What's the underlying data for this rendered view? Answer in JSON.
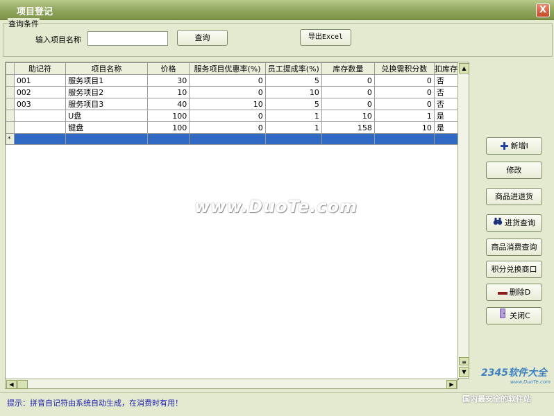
{
  "window": {
    "title": "项目登记",
    "close_label": "X"
  },
  "query": {
    "group_label": "查询条件",
    "name_label": "输入项目名称",
    "name_value": "",
    "query_button": "查询",
    "export_button": "导出Excel"
  },
  "grid": {
    "columns": [
      "助记符",
      "项目名称",
      "价格",
      "服务项目优惠率(%)",
      "员工提成率(%)",
      "库存数量",
      "兑换需积分数",
      "扣库存"
    ],
    "rows": [
      [
        "001",
        "服务项目1",
        "30",
        "0",
        "5",
        "0",
        "0",
        "否"
      ],
      [
        "002",
        "服务项目2",
        "10",
        "0",
        "10",
        "0",
        "0",
        "否"
      ],
      [
        "003",
        "服务项目3",
        "40",
        "10",
        "5",
        "0",
        "0",
        "否"
      ],
      [
        "",
        "U盘",
        "100",
        "0",
        "1",
        "10",
        "1",
        "是"
      ],
      [
        "",
        "键盘",
        "100",
        "0",
        "1",
        "158",
        "10",
        "是"
      ]
    ],
    "new_row_marker": "*"
  },
  "actions": {
    "add": "新增I",
    "edit": "修改",
    "returns": "商品进退货",
    "purchase_query": "进货查询",
    "consume_query": "商品消费查询",
    "points_exchange": "积分兑换商口",
    "delete": "删除D",
    "close": "关闭C"
  },
  "watermark": {
    "main": "www.DuoTe.com",
    "logo": "2345软件大全",
    "logo_sub": "www.DuoTe.com",
    "footer": "国内最安全的软件站"
  },
  "status": {
    "tip": "提示：拼音自记符由系统自动生成，在消费时有用！"
  },
  "colors": {
    "title_bar": "#8fa55c",
    "window_bg": "#e3eacf",
    "selection": "#316ac5",
    "tip_text": "#1b1bb0"
  }
}
